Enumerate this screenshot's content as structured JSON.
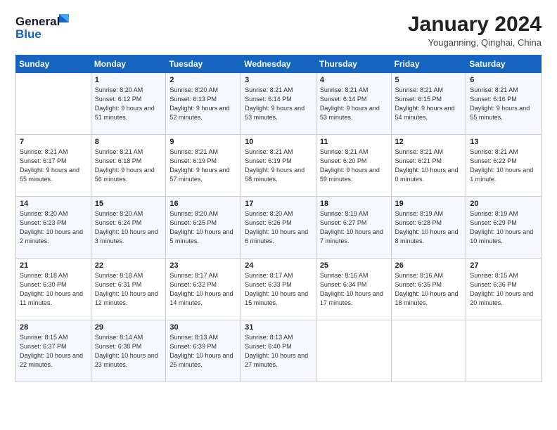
{
  "header": {
    "logo_line1": "General",
    "logo_line2": "Blue",
    "month_title": "January 2024",
    "location": "Youganning, Qinghai, China"
  },
  "days_of_week": [
    "Sunday",
    "Monday",
    "Tuesday",
    "Wednesday",
    "Thursday",
    "Friday",
    "Saturday"
  ],
  "weeks": [
    [
      {
        "num": "",
        "info": ""
      },
      {
        "num": "1",
        "info": "Sunrise: 8:20 AM\nSunset: 6:12 PM\nDaylight: 9 hours\nand 51 minutes."
      },
      {
        "num": "2",
        "info": "Sunrise: 8:20 AM\nSunset: 6:13 PM\nDaylight: 9 hours\nand 52 minutes."
      },
      {
        "num": "3",
        "info": "Sunrise: 8:21 AM\nSunset: 6:14 PM\nDaylight: 9 hours\nand 53 minutes."
      },
      {
        "num": "4",
        "info": "Sunrise: 8:21 AM\nSunset: 6:14 PM\nDaylight: 9 hours\nand 53 minutes."
      },
      {
        "num": "5",
        "info": "Sunrise: 8:21 AM\nSunset: 6:15 PM\nDaylight: 9 hours\nand 54 minutes."
      },
      {
        "num": "6",
        "info": "Sunrise: 8:21 AM\nSunset: 6:16 PM\nDaylight: 9 hours\nand 55 minutes."
      }
    ],
    [
      {
        "num": "7",
        "info": "Sunrise: 8:21 AM\nSunset: 6:17 PM\nDaylight: 9 hours\nand 55 minutes."
      },
      {
        "num": "8",
        "info": "Sunrise: 8:21 AM\nSunset: 6:18 PM\nDaylight: 9 hours\nand 56 minutes."
      },
      {
        "num": "9",
        "info": "Sunrise: 8:21 AM\nSunset: 6:19 PM\nDaylight: 9 hours\nand 57 minutes."
      },
      {
        "num": "10",
        "info": "Sunrise: 8:21 AM\nSunset: 6:19 PM\nDaylight: 9 hours\nand 58 minutes."
      },
      {
        "num": "11",
        "info": "Sunrise: 8:21 AM\nSunset: 6:20 PM\nDaylight: 9 hours\nand 59 minutes."
      },
      {
        "num": "12",
        "info": "Sunrise: 8:21 AM\nSunset: 6:21 PM\nDaylight: 10 hours\nand 0 minutes."
      },
      {
        "num": "13",
        "info": "Sunrise: 8:21 AM\nSunset: 6:22 PM\nDaylight: 10 hours\nand 1 minute."
      }
    ],
    [
      {
        "num": "14",
        "info": "Sunrise: 8:20 AM\nSunset: 6:23 PM\nDaylight: 10 hours\nand 2 minutes."
      },
      {
        "num": "15",
        "info": "Sunrise: 8:20 AM\nSunset: 6:24 PM\nDaylight: 10 hours\nand 3 minutes."
      },
      {
        "num": "16",
        "info": "Sunrise: 8:20 AM\nSunset: 6:25 PM\nDaylight: 10 hours\nand 5 minutes."
      },
      {
        "num": "17",
        "info": "Sunrise: 8:20 AM\nSunset: 6:26 PM\nDaylight: 10 hours\nand 6 minutes."
      },
      {
        "num": "18",
        "info": "Sunrise: 8:19 AM\nSunset: 6:27 PM\nDaylight: 10 hours\nand 7 minutes."
      },
      {
        "num": "19",
        "info": "Sunrise: 8:19 AM\nSunset: 6:28 PM\nDaylight: 10 hours\nand 8 minutes."
      },
      {
        "num": "20",
        "info": "Sunrise: 8:19 AM\nSunset: 6:29 PM\nDaylight: 10 hours\nand 10 minutes."
      }
    ],
    [
      {
        "num": "21",
        "info": "Sunrise: 8:18 AM\nSunset: 6:30 PM\nDaylight: 10 hours\nand 11 minutes."
      },
      {
        "num": "22",
        "info": "Sunrise: 8:18 AM\nSunset: 6:31 PM\nDaylight: 10 hours\nand 12 minutes."
      },
      {
        "num": "23",
        "info": "Sunrise: 8:17 AM\nSunset: 6:32 PM\nDaylight: 10 hours\nand 14 minutes."
      },
      {
        "num": "24",
        "info": "Sunrise: 8:17 AM\nSunset: 6:33 PM\nDaylight: 10 hours\nand 15 minutes."
      },
      {
        "num": "25",
        "info": "Sunrise: 8:16 AM\nSunset: 6:34 PM\nDaylight: 10 hours\nand 17 minutes."
      },
      {
        "num": "26",
        "info": "Sunrise: 8:16 AM\nSunset: 6:35 PM\nDaylight: 10 hours\nand 18 minutes."
      },
      {
        "num": "27",
        "info": "Sunrise: 8:15 AM\nSunset: 6:36 PM\nDaylight: 10 hours\nand 20 minutes."
      }
    ],
    [
      {
        "num": "28",
        "info": "Sunrise: 8:15 AM\nSunset: 6:37 PM\nDaylight: 10 hours\nand 22 minutes."
      },
      {
        "num": "29",
        "info": "Sunrise: 8:14 AM\nSunset: 6:38 PM\nDaylight: 10 hours\nand 23 minutes."
      },
      {
        "num": "30",
        "info": "Sunrise: 8:13 AM\nSunset: 6:39 PM\nDaylight: 10 hours\nand 25 minutes."
      },
      {
        "num": "31",
        "info": "Sunrise: 8:13 AM\nSunset: 6:40 PM\nDaylight: 10 hours\nand 27 minutes."
      },
      {
        "num": "",
        "info": ""
      },
      {
        "num": "",
        "info": ""
      },
      {
        "num": "",
        "info": ""
      }
    ]
  ]
}
